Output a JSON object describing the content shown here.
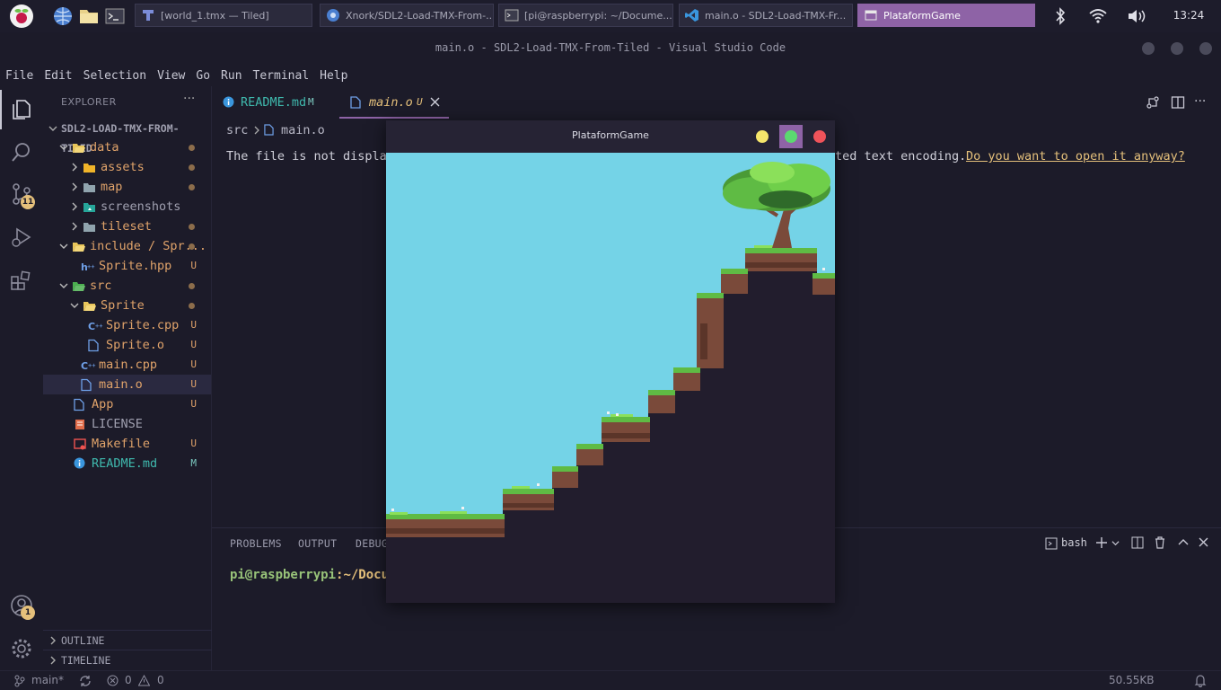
{
  "taskbar": {
    "tasks": [
      {
        "label": "[world_1.tmx — Tiled]"
      },
      {
        "label": "Xnork/SDL2-Load-TMX-From-..."
      },
      {
        "label": "[pi@raspberrypi: ~/Docume..."
      },
      {
        "label": "main.o - SDL2-Load-TMX-Fr..."
      },
      {
        "label": "PlataformGame"
      }
    ],
    "clock": "13:24"
  },
  "window_title": "main.o - SDL2-Load-TMX-From-Tiled - Visual Studio Code",
  "menu": [
    "File",
    "Edit",
    "Selection",
    "View",
    "Go",
    "Run",
    "Terminal",
    "Help"
  ],
  "activity": {
    "scm_badge": "11",
    "accounts_badge": "1"
  },
  "sidebar": {
    "header": "EXPLORER",
    "more": "···",
    "project": "SDL2-LOAD-TMX-FROM-TILED",
    "tree": [
      {
        "label": "data",
        "status": ""
      },
      {
        "label": "assets",
        "status": ""
      },
      {
        "label": "map",
        "status": ""
      },
      {
        "label": "screenshots",
        "status": ""
      },
      {
        "label": "tileset",
        "status": ""
      },
      {
        "label": "include / Spr...",
        "status": ""
      },
      {
        "label": "Sprite.hpp",
        "status": "U"
      },
      {
        "label": "src",
        "status": ""
      },
      {
        "label": "Sprite",
        "status": ""
      },
      {
        "label": "Sprite.cpp",
        "status": "U"
      },
      {
        "label": "Sprite.o",
        "status": "U"
      },
      {
        "label": "main.cpp",
        "status": "U"
      },
      {
        "label": "main.o",
        "status": "U"
      },
      {
        "label": "App",
        "status": "U"
      },
      {
        "label": "LICENSE",
        "status": ""
      },
      {
        "label": "Makefile",
        "status": "U"
      },
      {
        "label": "README.md",
        "status": "M"
      }
    ],
    "outline": "OUTLINE",
    "timeline": "TIMELINE"
  },
  "editor": {
    "tabs": [
      {
        "label": "README.md",
        "status": "M"
      },
      {
        "label": "main.o",
        "status": "U"
      }
    ],
    "breadcrumb": {
      "folder": "src",
      "file": "main.o"
    },
    "message_start": "The file is not display",
    "message_end": "ted text encoding.",
    "message_link": "Do you want to open it anyway?"
  },
  "panel": {
    "tabs": [
      "PROBLEMS",
      "OUTPUT",
      "DEBUG"
    ],
    "shell": "bash",
    "prompt_user": "pi@raspberrypi",
    "prompt_path": ":~/Docum"
  },
  "game": {
    "title": "PlataformGame"
  },
  "status": {
    "branch": "main*",
    "errors": "0",
    "warnings": "0",
    "filesize": "50.55KB"
  },
  "colors": {
    "accent": "#8e63a6",
    "sky": "#74d3e7",
    "modified": "#e5c07b",
    "untracked": "#e0a36a",
    "link": "#e5c07b"
  }
}
